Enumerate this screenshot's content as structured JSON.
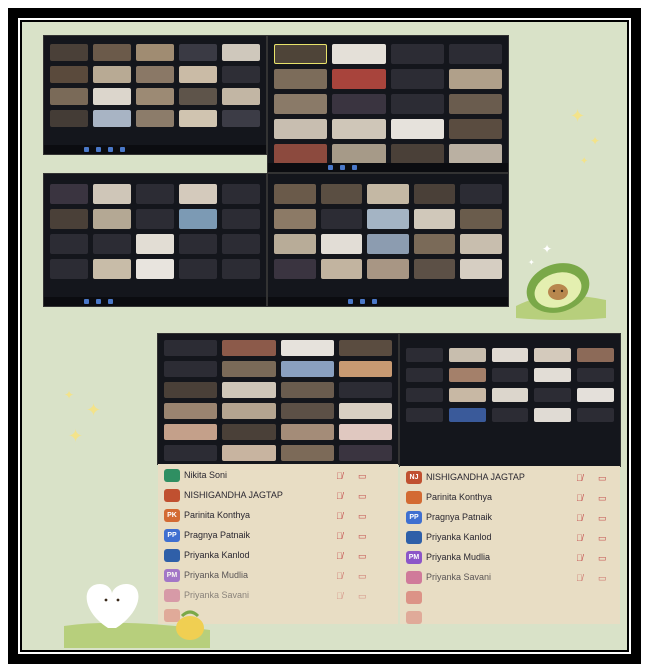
{
  "participants_left": [
    {
      "initials": "",
      "name": "Nikita Soni",
      "color": "#2f8f62"
    },
    {
      "initials": "",
      "name": "NISHIGANDHA JAGTAP",
      "color": "#c05030"
    },
    {
      "initials": "PK",
      "name": "Parinita Konthya",
      "color": "#d36a32"
    },
    {
      "initials": "PP",
      "name": "Pragnya Patnaik",
      "color": "#3f6fd0"
    },
    {
      "initials": "",
      "name": "Priyanka Kanlod",
      "color": "#2f5fa8"
    },
    {
      "initials": "PM",
      "name": "Priyanka Mudlia",
      "color": "#8c55c8"
    },
    {
      "initials": "",
      "name": "Priyanka Savani",
      "color": "#c85a8c"
    },
    {
      "initials": "",
      "name": "",
      "color": "#d04a4a"
    }
  ],
  "participants_right": [
    {
      "initials": "NJ",
      "name": "NISHIGANDHA JAGTAP",
      "color": "#c05030"
    },
    {
      "initials": "",
      "name": "Parinita Konthya",
      "color": "#d36a32"
    },
    {
      "initials": "PP",
      "name": "Pragnya Patnaik",
      "color": "#3f6fd0"
    },
    {
      "initials": "",
      "name": "Priyanka Kanlod",
      "color": "#2f5fa8"
    },
    {
      "initials": "PM",
      "name": "Priyanka Mudlia",
      "color": "#8c55c8"
    },
    {
      "initials": "",
      "name": "Priyanka Savani",
      "color": "#c85a8c"
    },
    {
      "initials": "",
      "name": "",
      "color": "#d04a4a"
    },
    {
      "initials": "",
      "name": "",
      "color": "#d04a4a"
    }
  ],
  "icons": {
    "mic": "mic-muted-icon",
    "video": "video-off-icon"
  },
  "colors": {
    "background": "#d9e2c8",
    "frame": "#000000",
    "screen": "#14161c",
    "panel": "#e8ddc4"
  }
}
